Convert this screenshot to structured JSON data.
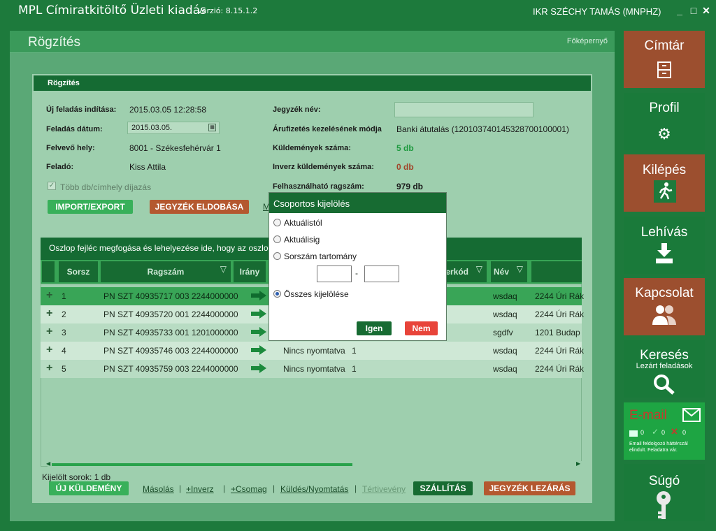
{
  "window": {
    "app_title": "MPL Címiratkitöltő Üzleti kiadás",
    "version": "Verzió: 8.15.1.2",
    "user": "IKR SZÉCHY TAMÁS (MNPHZ)",
    "controls": [
      "_",
      "□",
      "✕"
    ]
  },
  "page": {
    "title": "Rögzítés",
    "home_link": "Főképernyő"
  },
  "form": {
    "panel_title": "Rögzítés",
    "labels": {
      "new_start": "Új feladás indítása:",
      "post_date": "Feladás dátum:",
      "office": "Felvevő hely:",
      "sender": "Feladó:",
      "list_name": "Jegyzék név:",
      "payment": "Árufizetés kezelésének módja",
      "items": "Küldemények száma:",
      "inverse_items": "Inverz küldemények száma:",
      "usable_numbers": "Felhasználható ragszám:"
    },
    "values": {
      "new_start": "2015.03.05 12:28:58",
      "post_date": "2015.03.05.",
      "office": "8001 - Székesfehérvár 1",
      "sender": "Kiss Attila",
      "list_name": "",
      "payment": "Banki átutalás (12010374014532870010000​1)",
      "items": "5 db",
      "inverse_items": "0 db",
      "usable_numbers": "979 db"
    },
    "multi_checkbox": {
      "label": "Több db/címhely díjazás",
      "checked": true
    },
    "buttons": {
      "import_export": "IMPORT/EXPORT",
      "discard": "JEGYZÉK ELDOBÁSA",
      "hidden_link": "M"
    }
  },
  "grid": {
    "group_hint": "Oszlop fejléc megfogása és lehelyezése ide, hogy az oszlop",
    "columns": {
      "serial": "Sorsz",
      "tracking": "Ragszám",
      "direction": "Irány",
      "code": "erkód",
      "name": "Név"
    },
    "rows": [
      {
        "n": "1",
        "tracking": "PN SZT 40935717 003 2244000000",
        "status": "",
        "count": "",
        "name": "wsdaq",
        "addr": "2244 Úri Rák"
      },
      {
        "n": "2",
        "tracking": "PN SZT 40935720 001 2244000000",
        "status": "",
        "count": "",
        "name": "wsdaq",
        "addr": "2244 Úri Rák"
      },
      {
        "n": "3",
        "tracking": "PN SZT 40935733 001 1201000000",
        "status": "",
        "count": "",
        "name": "sgdfv",
        "addr": "1201 Budap"
      },
      {
        "n": "4",
        "tracking": "PN SZT 40935746 003 2244000000",
        "status": "Nincs nyomtatva",
        "count": "1",
        "name": "wsdaq",
        "addr": "2244 Úri Rák"
      },
      {
        "n": "5",
        "tracking": "PN SZT 40935759 003 2244000000",
        "status": "Nincs nyomtatva",
        "count": "1",
        "name": "wsdaq",
        "addr": "2244 Úri Rák"
      }
    ],
    "selected_rows": "Kijelölt sorok: 1 db"
  },
  "actions": {
    "new": "ÚJ KÜLDEMÉNY",
    "copy": "Másolás",
    "inverse": "+Inverz",
    "package": "+Csomag",
    "send": "Küldés/Nyomtatás",
    "receipt": "Tértivevény",
    "ship": "SZÁLLÍTÁS",
    "close_list": "JEGYZÉK LEZÁRÁS"
  },
  "sidebar": {
    "address_book": "Címtár",
    "profile": "Profil",
    "logout": "Kilépés",
    "download": "Lehívás",
    "contact": "Kapcsolat",
    "search": "Keresés",
    "search_sub": "Lezárt feladások",
    "email": "E-mail",
    "email_counts": [
      "0",
      "0",
      "0"
    ],
    "email_note": "Email feldolgozó háttérszál elindult. Feladatra vár.",
    "help": "Súgó"
  },
  "dialog": {
    "title": "Csoportos kijelölés",
    "options": [
      "Aktuálistól",
      "Aktuálisig",
      "Sorszám tartomány",
      "Összes kijelölése"
    ],
    "selected_index": 3,
    "range_from": "",
    "range_to": "",
    "range_dash": "-",
    "yes": "Igen",
    "no": "Nem"
  },
  "colors": {
    "dark_green": "#176b32",
    "brown": "#9c4f2f",
    "accent_red": "#e8443a"
  }
}
